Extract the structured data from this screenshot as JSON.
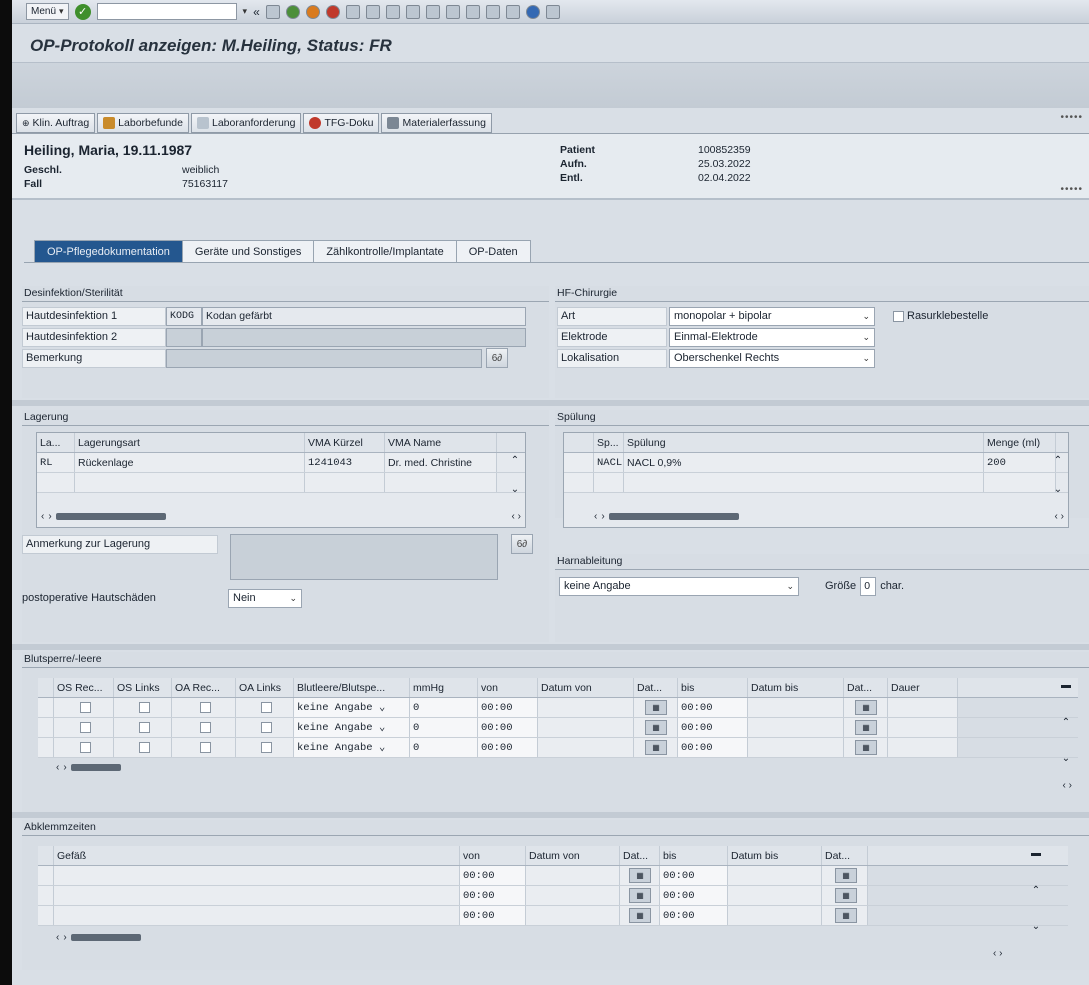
{
  "sysbar": {
    "menu_label": "Menü"
  },
  "title": "OP-Protokoll anzeigen: M.Heiling, Status: FR",
  "app_toolbar": [
    "Klin. Auftrag",
    "Laborbefunde",
    "Laboranforderung",
    "TFG-Doku",
    "Materialerfassung"
  ],
  "patient": {
    "name": "Heiling, Maria, 19.11.1987",
    "sex_label": "Geschl.",
    "sex": "weiblich",
    "case_label": "Fall",
    "case": "75163117",
    "pid_label": "Patient",
    "pid": "100852359",
    "adm_label": "Aufn.",
    "adm": "25.03.2022",
    "dis_label": "Entl.",
    "dis": "02.04.2022"
  },
  "tabs": [
    "OP-Pflegedokumentation",
    "Geräte und Sonstiges",
    "Zählkontrolle/Implantate",
    "OP-Daten"
  ],
  "desinfektion": {
    "title": "Desinfektion/Sterilität",
    "r1_label": "Hautdesinfektion 1",
    "r1_code": "KODG",
    "r1_text": "Kodan gefärbt",
    "r2_label": "Hautdesinfektion 2",
    "r3_label": "Bemerkung"
  },
  "hf": {
    "title": "HF-Chirurgie",
    "art_label": "Art",
    "art": "monopolar + bipolar",
    "elek_label": "Elektrode",
    "elek": "Einmal-Elektrode",
    "lok_label": "Lokalisation",
    "lok": "Oberschenkel Rechts",
    "rasur_label": "Rasurklebestelle"
  },
  "lagerung": {
    "title": "Lagerung",
    "headers": [
      "La...",
      "Lagerungsart",
      "VMA Kürzel",
      "VMA Name"
    ],
    "row": [
      "RL",
      "Rückenlage",
      "1241043",
      "Dr. med. Christine"
    ],
    "anm_label": "Anmerkung zur Lagerung",
    "haut_label": "postoperative Hautschäden",
    "haut": "Nein"
  },
  "spuelung": {
    "title": "Spülung",
    "headers": [
      "Sp...",
      "Spülung",
      "Menge (ml)"
    ],
    "row": [
      "NACL",
      "NACL 0,9%",
      "200"
    ]
  },
  "harn": {
    "title": "Harnableitung",
    "value": "keine Angabe",
    "size_label": "Größe",
    "size": "0",
    "unit": "char."
  },
  "blut": {
    "title": "Blutsperre/-leere",
    "headers": [
      "OS Rec...",
      "OS Links",
      "OA Rec...",
      "OA Links",
      "Blutleere/Blutspe...",
      "mmHg",
      "von",
      "Datum von",
      "Dat...",
      "bis",
      "Datum bis",
      "Dat...",
      "Dauer"
    ],
    "type": "keine Angabe",
    "mmhg": "0",
    "von": "00:00",
    "bis": "00:00"
  },
  "abkl": {
    "title": "Abklemmzeiten",
    "headers": [
      "Gefäß",
      "von",
      "Datum von",
      "Dat...",
      "bis",
      "Datum bis",
      "Dat..."
    ],
    "von": "00:00",
    "bis": "00:00"
  }
}
